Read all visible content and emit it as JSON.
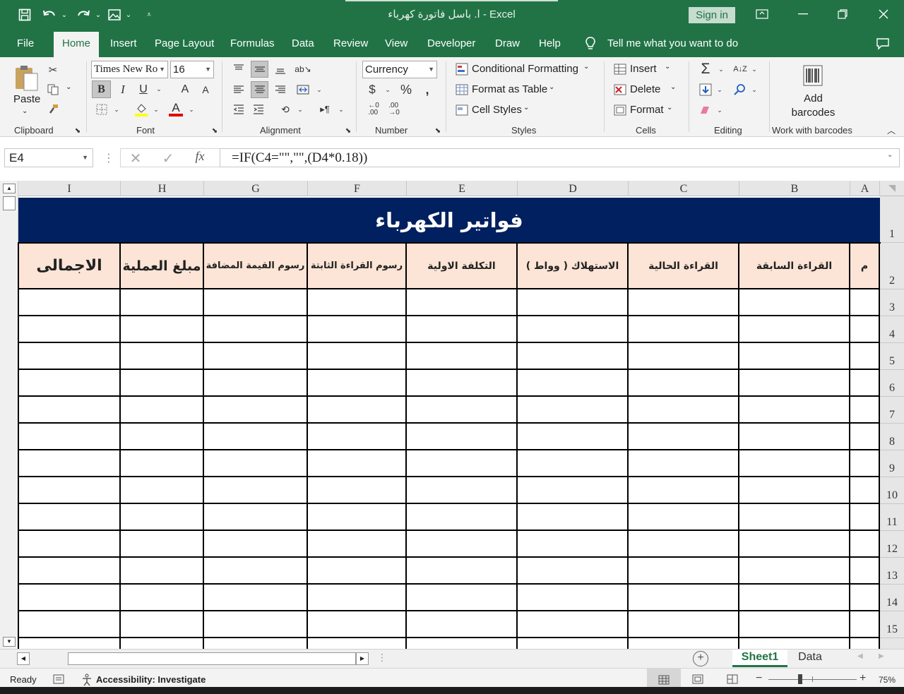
{
  "window": {
    "title": "ا. باسل فاتورة كهرباء  -  Excel",
    "sign_in": "Sign in"
  },
  "tabs": [
    "File",
    "Home",
    "Insert",
    "Page Layout",
    "Formulas",
    "Data",
    "Review",
    "View",
    "Developer",
    "Draw",
    "Help"
  ],
  "active_tab": "Home",
  "tell_me": "Tell me what you want to do",
  "ribbon": {
    "clipboard": {
      "label": "Clipboard",
      "paste": "Paste"
    },
    "font": {
      "label": "Font",
      "name": "Times New Ro",
      "size": "16",
      "bold": "B",
      "italic": "I",
      "underline": "U",
      "grow": "A",
      "shrink": "A",
      "color": "A"
    },
    "alignment": {
      "label": "Alignment"
    },
    "number": {
      "label": "Number",
      "format": "Currency",
      "currency_symbol": "$",
      "percent": "%",
      "comma": ","
    },
    "styles": {
      "label": "Styles",
      "conditional": "Conditional Formatting",
      "table": "Format as Table",
      "cell_styles": "Cell Styles"
    },
    "cells": {
      "label": "Cells",
      "insert": "Insert",
      "delete": "Delete",
      "format": "Format"
    },
    "editing": {
      "label": "Editing"
    },
    "barcodes": {
      "label": "Work with barcodes",
      "add_line1": "Add",
      "add_line2": "barcodes"
    }
  },
  "formula_bar": {
    "name_box": "E4",
    "fx": "fx",
    "formula": "=IF(C4=\"\",\"\",(D4*0.18))"
  },
  "sheet": {
    "columns": [
      "I",
      "H",
      "G",
      "F",
      "E",
      "D",
      "C",
      "B",
      "A"
    ],
    "rows": [
      "1",
      "2",
      "3",
      "4",
      "5",
      "6",
      "7",
      "8",
      "9",
      "10",
      "11",
      "12",
      "13",
      "14",
      "15"
    ],
    "banner": "فواتير الكهرباء",
    "headers": [
      "الاجمالى",
      "مبلغ العملية",
      "رسوم القيمة المضافة",
      "رسوم القراءة الثابتة",
      "التكلفة الاولية",
      "الاستهلاك ( وواط )",
      "القراءة الحالية",
      "القراءة السابقة",
      "م"
    ]
  },
  "sheet_tabs": [
    "Sheet1",
    "Data"
  ],
  "active_sheet": "Sheet1",
  "status": {
    "ready": "Ready",
    "accessibility": "Accessibility: Investigate",
    "zoom": "75%",
    "minus": "−",
    "plus": "+"
  },
  "colors": {
    "excel_green": "#217346",
    "banner": "#002060",
    "header_fill": "#fce4d6"
  }
}
